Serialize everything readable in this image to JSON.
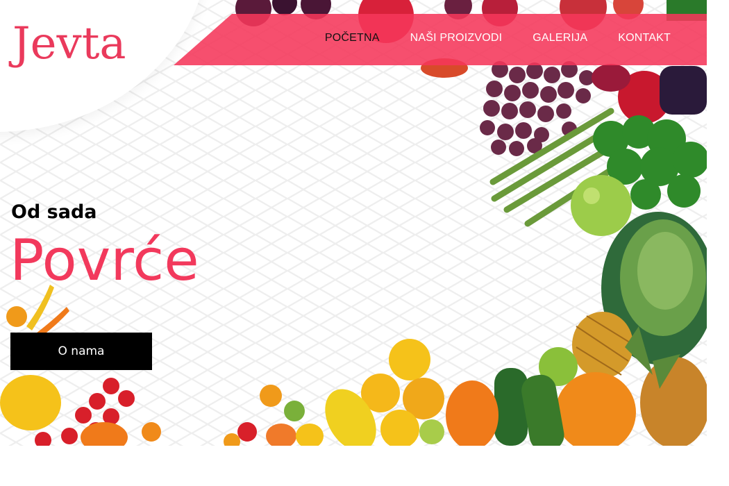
{
  "header": {
    "logo_text": "Jevta",
    "nav": [
      {
        "label": "POČETNA",
        "active": true
      },
      {
        "label": "NAŠI PROIZVODI",
        "active": false
      },
      {
        "label": "GALERIJA",
        "active": false
      },
      {
        "label": "KONTAKT",
        "active": false
      }
    ]
  },
  "hero": {
    "eyebrow": "Od sada",
    "headline": "Povrće",
    "cta_label": "O nama",
    "image_icon": "fruits-and-vegetables-photo"
  },
  "colors": {
    "accent": "#f2395c",
    "nav_band": "#f5375a",
    "cta_background": "#000000"
  }
}
